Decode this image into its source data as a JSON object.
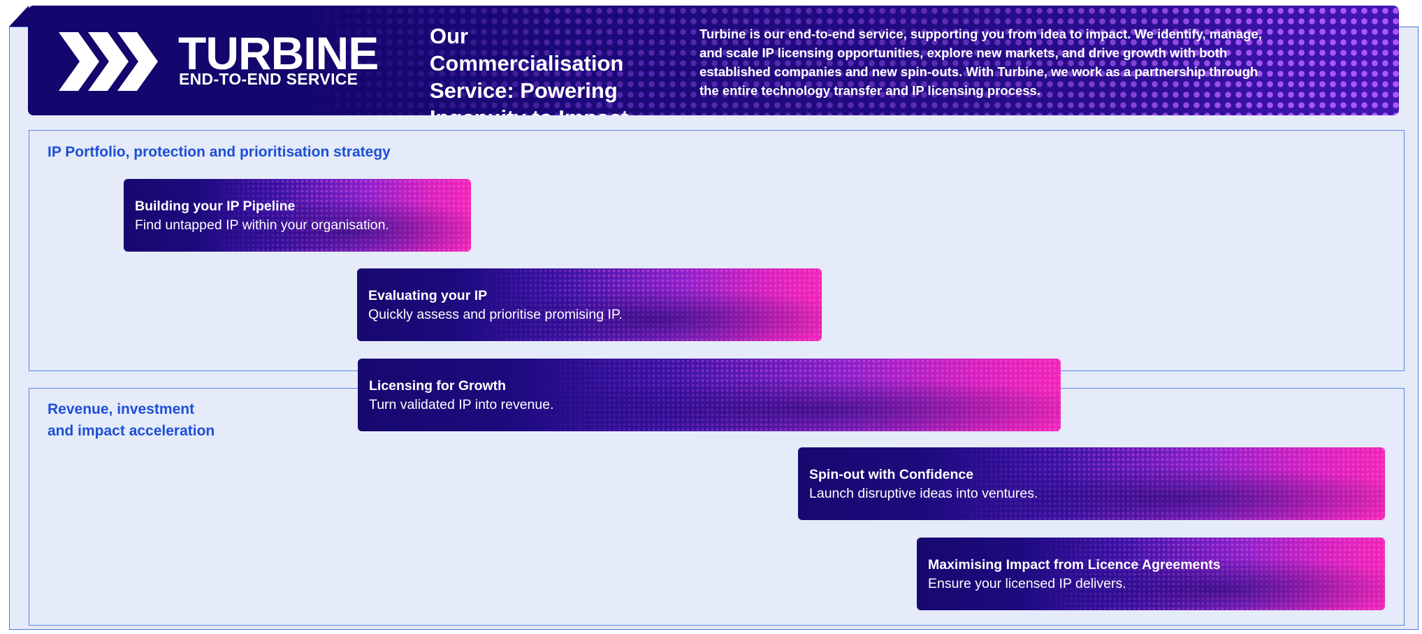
{
  "header": {
    "logo_title": "TURBINE",
    "logo_subtitle": "END-TO-END SERVICE",
    "heading": "Our Commercialisation Service: Powering Ingenuity to Impact",
    "description": "Turbine is our end-to-end service, supporting you from idea to impact. We identify, manage, and scale IP licensing opportunities, explore new markets, and drive growth with both established companies and new spin-outs. With Turbine, we work as a partnership through the entire technology transfer and IP licensing process.",
    "logo_icon": "triple-chevron-icon"
  },
  "sections": [
    {
      "title": "IP Portfolio, protection and prioritisation strategy"
    },
    {
      "title_line_1": "Revenue, investment",
      "title_line_2": "and impact acceleration"
    }
  ],
  "steps": [
    {
      "title": "Building your IP Pipeline",
      "description": "Find untapped IP within your organisation."
    },
    {
      "title": "Evaluating your IP",
      "description": "Quickly assess and prioritise promising IP."
    },
    {
      "title": "Licensing for Growth",
      "description": "Turn validated IP into revenue."
    },
    {
      "title": "Spin-out with Confidence",
      "description": "Launch disruptive ideas into ventures."
    },
    {
      "title": "Maximising Impact from Licence Agreements",
      "description": "Ensure your licensed IP delivers."
    }
  ],
  "colors": {
    "header_navy": "#13066c",
    "accent_blue": "#1d4fd6",
    "frame_blue": "#4a75e0",
    "panel_background": "#e5ebf9",
    "gradient_pink": "#f224b8",
    "gradient_purple": "#8a20cc"
  }
}
